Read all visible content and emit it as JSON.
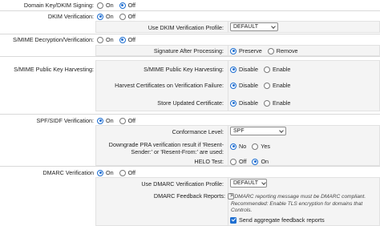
{
  "radio_on": "On",
  "radio_off": "Off",
  "radio_preserve": "Preserve",
  "radio_remove": "Remove",
  "radio_disable": "Disable",
  "radio_enable": "Enable",
  "radio_no": "No",
  "radio_yes": "Yes",
  "domain_key": {
    "label": "Domain Key/DKIM Signing:",
    "selected": "Off"
  },
  "dkim_verification": {
    "label": "DKIM Verification:",
    "selected": "On",
    "profile_label": "Use DKIM Verification Profile:",
    "profile_value": "DEFAULT"
  },
  "smime_decryption": {
    "label": "S/MIME Decryption/Verification:",
    "selected": "Off",
    "signature_label": "Signature After Processing:",
    "signature_selected": "Preserve"
  },
  "smime_harvesting": {
    "label": "S/MIME Public Key Harvesting:",
    "sub_label": "S/MIME Public Key Harvesting:",
    "sub_selected": "Disable",
    "failure_label": "Harvest Certificates on Verification Failure:",
    "failure_selected": "Disable",
    "store_label": "Store Updated Certificate:",
    "store_selected": "Disable"
  },
  "spf": {
    "label": "SPF/SIDF Verification:",
    "selected": "On",
    "conformance_label": "Conformance Level:",
    "conformance_value": "SPF",
    "downgrade_label_1": "Downgrade PRA verification result if 'Resent-",
    "downgrade_label_2": "Sender:' or 'Resent-From:' are used:",
    "downgrade_selected": "No",
    "helo_label": "HELO Test:",
    "helo_selected": "On"
  },
  "dmarc": {
    "label": "DMARC Verification",
    "selected": "On",
    "profile_label": "Use DMARC Verification Profile:",
    "profile_value": "DEFAULT",
    "feedback_label": "DMARC Feedback Reports:",
    "help_glyph": "?",
    "note_1": "* DMARC reporting message must be DMARC compliant.",
    "note_2": "Recommended: Enable TLS encryption for domains that",
    "note_3": "Controls.",
    "send_report_label": "Send aggregate feedback reports",
    "send_report_checked": true
  }
}
